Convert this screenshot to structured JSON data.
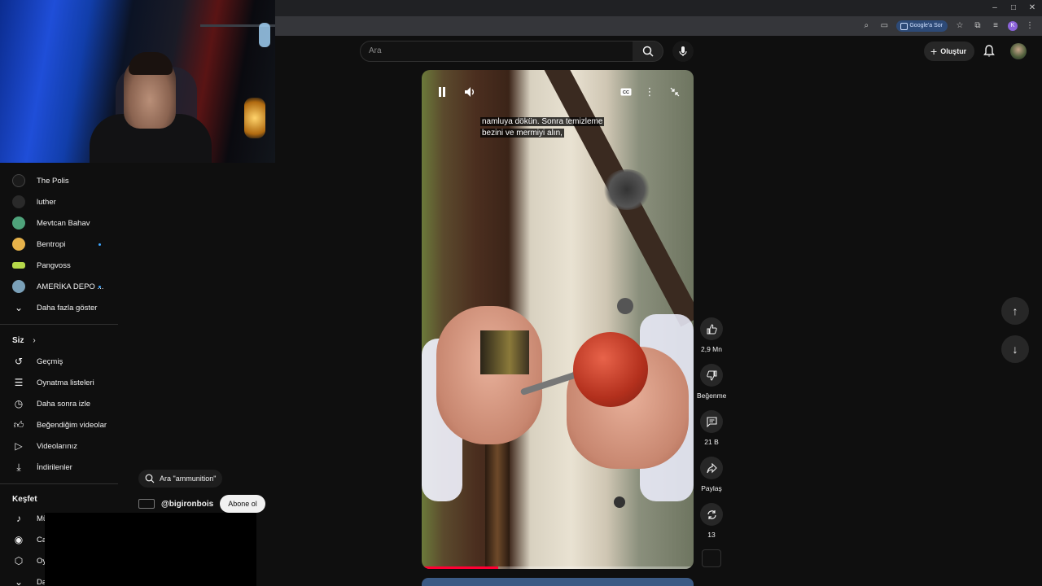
{
  "browser": {
    "google_button": "Google'a Sor",
    "profile_initial": "K",
    "window_controls": [
      "minimize",
      "maximize",
      "close"
    ]
  },
  "header": {
    "search_placeholder": "Ara",
    "create_label": "Oluştur"
  },
  "sidebar": {
    "subscriptions": [
      {
        "label": "The Polis",
        "color": "#1b1b1b",
        "new": false
      },
      {
        "label": "luther",
        "color": "#2a2a2a",
        "new": false
      },
      {
        "label": "Mevtcan Bahav",
        "color": "#4fa37b",
        "new": false
      },
      {
        "label": "Bentropi",
        "color": "#e6b24a",
        "new": true
      },
      {
        "label": "Pangvoss",
        "color": "#b6d84a",
        "new": false
      },
      {
        "label": "AMERİKA DEPO ...",
        "color": "#7aa0b8",
        "new": true
      }
    ],
    "show_more": "Daha fazla göster",
    "you_section": "Siz",
    "you_items": [
      {
        "label": "Geçmiş",
        "icon": "history-icon"
      },
      {
        "label": "Oynatma listeleri",
        "icon": "playlist-icon"
      },
      {
        "label": "Daha sonra izle",
        "icon": "clock-icon"
      },
      {
        "label": "Beğendiğim videolar",
        "icon": "thumb-up-icon"
      },
      {
        "label": "Videolarınız",
        "icon": "video-icon"
      },
      {
        "label": "İndirilenler",
        "icon": "download-icon"
      }
    ],
    "explore_section": "Keşfet",
    "explore_items": [
      {
        "label": "Mü",
        "icon": "music-icon"
      },
      {
        "label": "Ca",
        "icon": "live-icon"
      },
      {
        "label": "Oy",
        "icon": "gaming-icon"
      },
      {
        "label": "Da",
        "icon": "chevron-down-icon"
      }
    ]
  },
  "video": {
    "caption_line1": "namluya dökün. Sonra temizleme",
    "caption_line2": "bezini ve mermiyi alın,",
    "progress_fraction": 0.28
  },
  "actions": {
    "likes": "2,9 Mn",
    "dislike": "Beğenme",
    "comments": "21 B",
    "share": "Paylaş",
    "remix": "13"
  },
  "overlay": {
    "search_suggest": "Ara \"ammunition\"",
    "channel_handle": "@bigironbois",
    "subscribe": "Abone ol"
  }
}
